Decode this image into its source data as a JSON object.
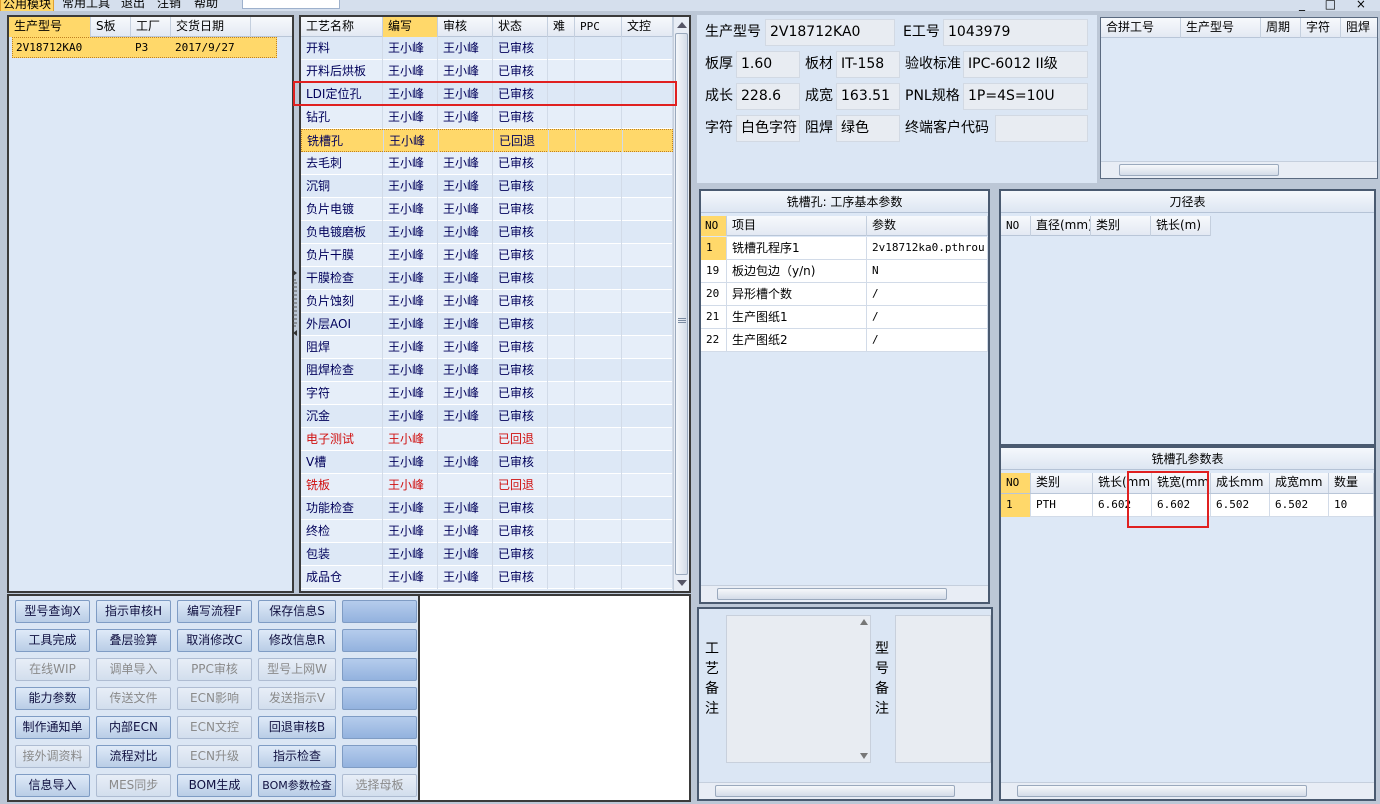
{
  "menu": {
    "items": [
      "公用模块",
      "常用工具",
      "退出",
      "注销",
      "帮助"
    ],
    "window_controls": "_ □ ×"
  },
  "model_list": {
    "headers": [
      "生产型号",
      "S板",
      "工厂",
      "交货日期"
    ],
    "row": {
      "model": "2V18712KA0",
      "s_board": "",
      "factory": "P3",
      "date": "2017/9/27"
    }
  },
  "process": {
    "headers": [
      "工艺名称",
      "编写",
      "审核",
      "状态",
      "难",
      "PPC",
      "文控"
    ],
    "rows": [
      {
        "name": "开料",
        "writer": "王小峰",
        "reviewer": "王小峰",
        "status": "已审核"
      },
      {
        "name": "开料后烘板",
        "writer": "王小峰",
        "reviewer": "王小峰",
        "status": "已审核"
      },
      {
        "name": "LDI定位孔",
        "writer": "王小峰",
        "reviewer": "王小峰",
        "status": "已审核"
      },
      {
        "name": "钻孔",
        "writer": "王小峰",
        "reviewer": "王小峰",
        "status": "已审核"
      },
      {
        "name": "铣槽孔",
        "writer": "王小峰",
        "reviewer": "",
        "status": "已回退"
      },
      {
        "name": "去毛刺",
        "writer": "王小峰",
        "reviewer": "王小峰",
        "status": "已审核"
      },
      {
        "name": "沉铜",
        "writer": "王小峰",
        "reviewer": "王小峰",
        "status": "已审核"
      },
      {
        "name": "负片电镀",
        "writer": "王小峰",
        "reviewer": "王小峰",
        "status": "已审核"
      },
      {
        "name": "负电镀磨板",
        "writer": "王小峰",
        "reviewer": "王小峰",
        "status": "已审核"
      },
      {
        "name": "负片干膜",
        "writer": "王小峰",
        "reviewer": "王小峰",
        "status": "已审核"
      },
      {
        "name": "干膜检查",
        "writer": "王小峰",
        "reviewer": "王小峰",
        "status": "已审核"
      },
      {
        "name": "负片蚀刻",
        "writer": "王小峰",
        "reviewer": "王小峰",
        "status": "已审核"
      },
      {
        "name": "外层AOI",
        "writer": "王小峰",
        "reviewer": "王小峰",
        "status": "已审核"
      },
      {
        "name": "阻焊",
        "writer": "王小峰",
        "reviewer": "王小峰",
        "status": "已审核"
      },
      {
        "name": "阻焊检查",
        "writer": "王小峰",
        "reviewer": "王小峰",
        "status": "已审核"
      },
      {
        "name": "字符",
        "writer": "王小峰",
        "reviewer": "王小峰",
        "status": "已审核"
      },
      {
        "name": "沉金",
        "writer": "王小峰",
        "reviewer": "王小峰",
        "status": "已审核"
      },
      {
        "name": "电子测试",
        "writer": "王小峰",
        "reviewer": "",
        "status": "已回退"
      },
      {
        "name": "V槽",
        "writer": "王小峰",
        "reviewer": "王小峰",
        "status": "已审核"
      },
      {
        "name": "铣板",
        "writer": "王小峰",
        "reviewer": "",
        "status": "已回退"
      },
      {
        "name": "功能检查",
        "writer": "王小峰",
        "reviewer": "王小峰",
        "status": "已审核"
      },
      {
        "name": "终检",
        "writer": "王小峰",
        "reviewer": "王小峰",
        "status": "已审核"
      },
      {
        "name": "包装",
        "writer": "王小峰",
        "reviewer": "王小峰",
        "status": "已审核"
      },
      {
        "name": "成品仓",
        "writer": "王小峰",
        "reviewer": "王小峰",
        "status": "已审核"
      }
    ]
  },
  "buttons": [
    [
      "型号查询X",
      "指示审核H",
      "编写流程F",
      "保存信息S",
      ""
    ],
    [
      "工具完成",
      "叠层验算",
      "取消修改C",
      "修改信息R",
      ""
    ],
    [
      "在线WIP",
      "调单导入",
      "PPC审核",
      "型号上网W",
      ""
    ],
    [
      "能力参数",
      "传送文件",
      "ECN影响",
      "发送指示V",
      ""
    ],
    [
      "制作通知单",
      "内部ECN",
      "ECN文控",
      "回退审核B",
      ""
    ],
    [
      "接外调资料",
      "流程对比",
      "ECN升级",
      "指示检查",
      ""
    ],
    [
      "信息导入",
      "MES同步",
      "BOM生成",
      "BOM参数检查",
      "选择母板"
    ]
  ],
  "info": {
    "model_label": "生产型号",
    "model": "2V18712KA0",
    "e_label": "E工号",
    "e_no": "1043979",
    "thick_label": "板厚",
    "thick": "1.60",
    "mat_label": "板材",
    "mat": "IT-158",
    "std_label": "验收标准",
    "std": "IPC-6012 II级",
    "len_label": "成长",
    "len": "228.6",
    "wid_label": "成宽",
    "wid": "163.51",
    "pnl_label": "PNL规格",
    "pnl": "1P=4S=10U",
    "char_label": "字符",
    "char": "白色字符",
    "mask_label": "阻焊",
    "mask": "绿色",
    "cust_label": "终端客户代码",
    "cust": ""
  },
  "merge": {
    "headers": [
      "合拼工号",
      "生产型号",
      "周期",
      "字符",
      "阻焊"
    ]
  },
  "params": {
    "title": "铣槽孔: 工序基本参数",
    "headers": [
      "NO",
      "项目",
      "参数"
    ],
    "rows": [
      {
        "no": "1",
        "item": "铣槽孔程序1",
        "value": "2v18712ka0.pthrou"
      },
      {
        "no": "19",
        "item": "板边包边（y/n)",
        "value": "N"
      },
      {
        "no": "20",
        "item": "异形槽个数",
        "value": "/"
      },
      {
        "no": "21",
        "item": "生产图纸1",
        "value": "/"
      },
      {
        "no": "22",
        "item": "生产图纸2",
        "value": "/"
      }
    ]
  },
  "tool_table": {
    "title": "刀径表",
    "headers": [
      "NO",
      "直径(mm)",
      "类别",
      "铣长(m)"
    ]
  },
  "slot_params": {
    "title": "铣槽孔参数表",
    "headers": [
      "NO",
      "类别",
      "铣长(mm)",
      "铣宽(mm)",
      "成长mm",
      "成宽mm",
      "数量"
    ],
    "rows": [
      {
        "no": "1",
        "type": "PTH",
        "len": "6.602",
        "wid": "6.602",
        "flen": "6.502",
        "fwid": "6.502",
        "qty": "10"
      }
    ]
  },
  "notes": {
    "process_label": "工艺备注",
    "model_label": "型号备注"
  },
  "colors": {
    "selected_row": "#ffd86a",
    "highlight_box": "#e02020",
    "returned_text": "#d01010"
  }
}
